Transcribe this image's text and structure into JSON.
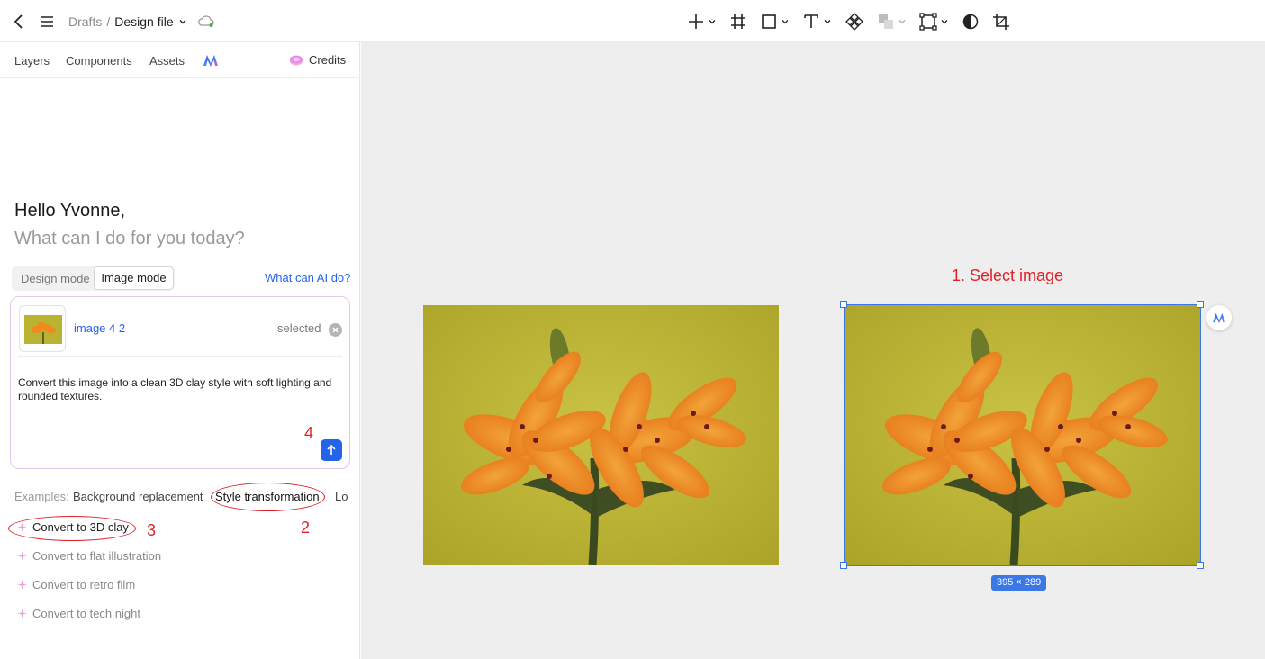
{
  "header": {
    "breadcrumb_root": "Drafts",
    "breadcrumb_sep": "/",
    "file_name": "Design file"
  },
  "toolbar": {
    "tools": [
      "add-icon",
      "frame-icon",
      "rectangle-icon",
      "text-icon",
      "component-icon",
      "boolean-icon",
      "vector-network-icon",
      "mask-icon",
      "crop-icon"
    ]
  },
  "sidebar": {
    "tabs": [
      "Layers",
      "Components",
      "Assets"
    ],
    "credits_label": "Credits"
  },
  "ai_panel": {
    "greeting": "Hello Yvonne,",
    "subgreeting": "What can I do for you today?",
    "mode_design": "Design mode",
    "mode_image": "Image mode",
    "help_link": "What can AI do?",
    "selection": {
      "name": "image 4 2",
      "status": "selected"
    },
    "prompt": "Convert this image into a clean 3D clay style with soft lighting and rounded textures.",
    "examples_label": "Examples:",
    "examples": [
      "Background replacement",
      "Style transformation",
      "Lo"
    ],
    "suggestions": [
      "Convert to 3D clay",
      "Convert to flat illustration",
      "Convert to retro film",
      "Convert to tech night"
    ]
  },
  "annotations": {
    "step1": "1. Select image",
    "step2": "2",
    "step3": "3",
    "step4": "4"
  },
  "canvas": {
    "selection_size": "395 × 289"
  },
  "colors": {
    "accent": "#2563eb",
    "selection": "#3a78e8",
    "annotation": "#e0232a",
    "canvas_bg": "#eeeeee"
  }
}
